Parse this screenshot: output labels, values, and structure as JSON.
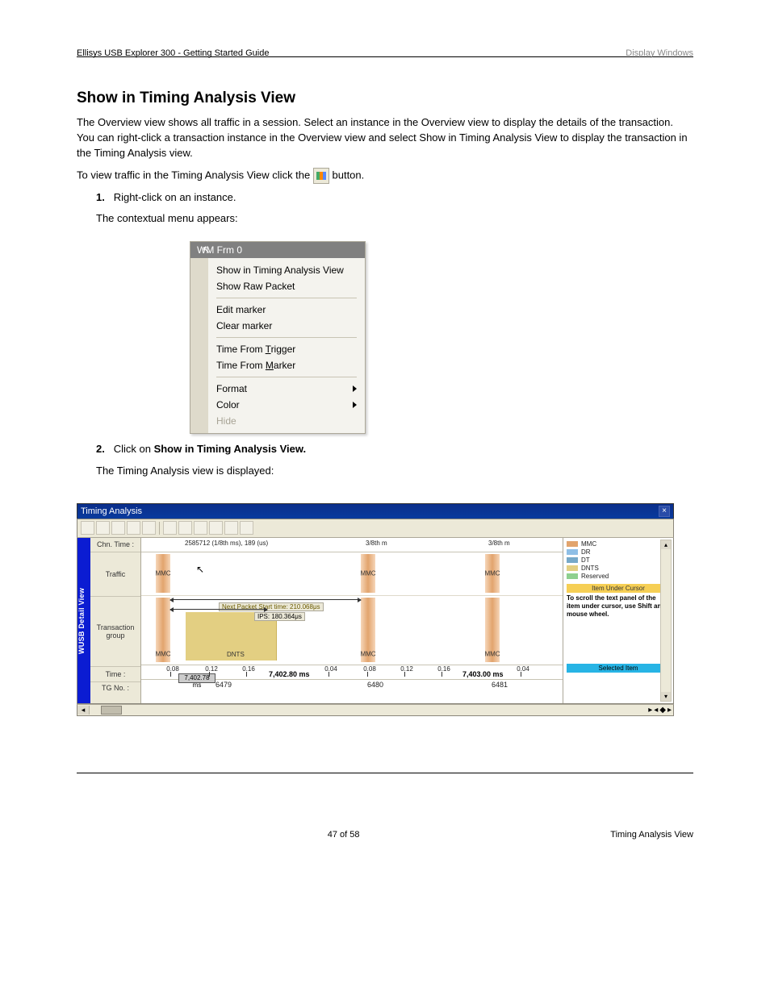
{
  "header": {
    "left": "Ellisys USB Explorer 300 - Getting Started Guide",
    "right_muted": "Display Windows"
  },
  "section1": {
    "title": "Show in Timing Analysis View",
    "p1": "The Overview view shows all traffic in a session. Select an instance in the Overview view to display the details of the transaction. You can right-click a transaction instance in the Overview view and select Show in Timing Analysis View to display the transaction in the Timing Analysis view.",
    "p2_prefix": "To view traffic in the Timing Analysis View click the ",
    "p2_suffix": " button.",
    "steps_1_strong": "1.",
    "steps_1_text": "Right-click on an instance.",
    "steps_2_line": "The contextual menu appears:"
  },
  "context_menu": {
    "title": "WM Frm 0",
    "items": [
      {
        "label": "Show in Timing Analysis View",
        "sub": false,
        "disabled": false
      },
      {
        "label": "Show Raw Packet",
        "sub": false,
        "disabled": false
      },
      {
        "sep": true
      },
      {
        "label": "Edit marker",
        "sub": false,
        "disabled": false
      },
      {
        "label": "Clear marker",
        "sub": false,
        "disabled": false
      },
      {
        "sep": true
      },
      {
        "label": "Time From Trigger",
        "underline_idx": 10
      },
      {
        "label": "Time From Marker",
        "underline_idx": 10
      },
      {
        "sep": true
      },
      {
        "label": "Format",
        "sub": true
      },
      {
        "label": "Color",
        "sub": true
      },
      {
        "label": "Hide",
        "disabled": true
      }
    ]
  },
  "section1b": {
    "step2_strong": "2.",
    "step2_text_a": "Click on",
    "step2_text_b": "The Timing Analysis view is displayed:",
    "step2_link": "Show in Timing Analysis View."
  },
  "timing_view": {
    "title": "Timing Analysis",
    "vtab": "WUSB Detail View",
    "rows": {
      "chn": "Chn. Time :",
      "traffic": "Traffic",
      "tgrp": "Transaction group",
      "time": "Time :",
      "tgno": "TG No. :"
    },
    "chn_labels": [
      "2585712 (1/8th ms), 189 (us)",
      "3/8th m",
      "3/8th m"
    ],
    "mmc_label": "MMC",
    "dnts_label": "DNTS",
    "ips_label": "IPS: 180.364μs",
    "next_pkt": "Next Packet Start time: 210.068μs",
    "time_minor": [
      "0.08",
      "0.12",
      "0.16",
      "0.04",
      "0.08",
      "0.12",
      "0.16",
      "0.04"
    ],
    "time_major": [
      "7,402.80 ms",
      "7,403.00 ms"
    ],
    "tg_values": [
      "6479",
      "6480",
      "6481"
    ],
    "marker": "7,402.78 ms",
    "legend": [
      {
        "color": "#e2a46d",
        "name": "MMC"
      },
      {
        "color": "#8fbfe6",
        "name": "DR"
      },
      {
        "color": "#77a9c9",
        "name": "DT"
      },
      {
        "color": "#e3cf82",
        "name": "DNTS"
      },
      {
        "color": "#8fd08f",
        "name": "Reserved"
      }
    ],
    "right_panel": {
      "cursor_head": "Item Under Cursor",
      "hint": "To scroll the text panel of the item under cursor, use Shift and mouse wheel.",
      "selected_head": "Selected Item"
    }
  },
  "footer": {
    "center": "47 of 58",
    "right": "Timing Analysis View"
  }
}
